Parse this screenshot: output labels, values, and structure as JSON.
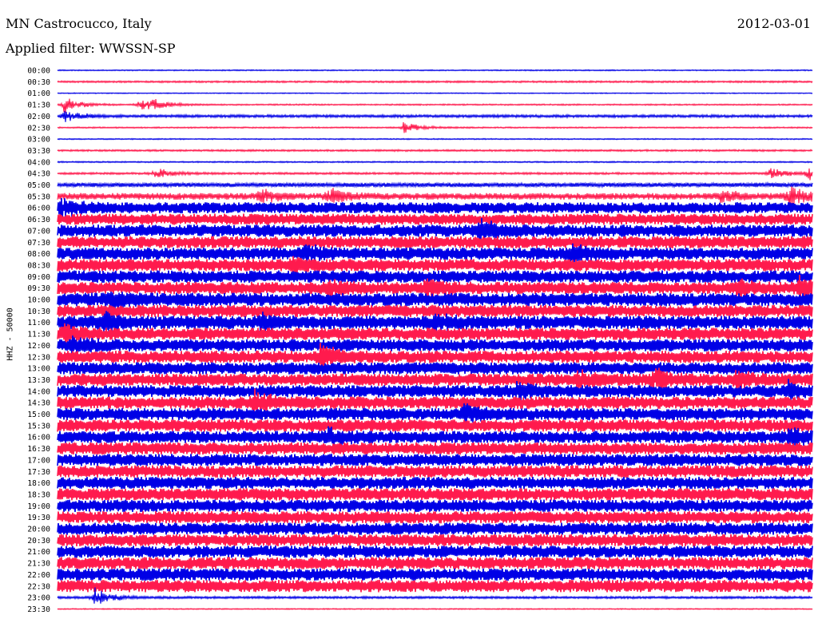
{
  "header": {
    "station": "MN Castrocucco, Italy",
    "date": "2012-03-01",
    "filter": "Applied filter: WWSSN-SP"
  },
  "colors": {
    "odd_trace": "#0000e6",
    "even_trace": "#ff1a4d"
  },
  "chart_data": {
    "type": "line",
    "title": "MN Castrocucco, Italy",
    "subtitle": "Applied filter: WWSSN-SP",
    "ylabel": "HHZ - 50000",
    "grid": false,
    "row_labels": [
      "00:00",
      "00:30",
      "01:00",
      "01:30",
      "02:00",
      "02:30",
      "03:00",
      "03:30",
      "04:00",
      "04:30",
      "05:00",
      "05:30",
      "06:00",
      "06:30",
      "07:00",
      "07:30",
      "08:00",
      "08:30",
      "09:00",
      "09:30",
      "10:00",
      "10:30",
      "11:00",
      "11:30",
      "12:00",
      "12:30",
      "13:00",
      "13:30",
      "14:00",
      "14:30",
      "15:00",
      "15:30",
      "16:00",
      "16:30",
      "17:00",
      "17:30",
      "18:00",
      "18:30",
      "19:00",
      "19:30",
      "20:00",
      "20:30",
      "21:00",
      "21:30",
      "22:00",
      "22:30",
      "23:00",
      "23:30"
    ],
    "noise_level": [
      0.5,
      0.8,
      0.4,
      0.6,
      1.2,
      0.6,
      0.5,
      0.8,
      0.6,
      0.9,
      2.0,
      3.0,
      5.0,
      5.0,
      5.5,
      5.5,
      5.5,
      5.5,
      5.5,
      5.5,
      6.0,
      5.5,
      6.0,
      5.5,
      5.5,
      5.5,
      5.5,
      5.5,
      5.5,
      5.5,
      5.5,
      5.5,
      5.5,
      5.5,
      5.5,
      5.5,
      5.5,
      5.5,
      5.5,
      5.5,
      5.5,
      5.5,
      5.5,
      5.5,
      5.5,
      5.5,
      1.0,
      0.5
    ],
    "events": [
      {
        "row": "01:30",
        "x_frac": 0.01,
        "amp": 10
      },
      {
        "row": "01:30",
        "x_frac": 0.11,
        "amp": 8
      },
      {
        "row": "01:30",
        "x_frac": 0.127,
        "amp": 5
      },
      {
        "row": "02:00",
        "x_frac": 0.01,
        "amp": 8
      },
      {
        "row": "02:30",
        "x_frac": 0.46,
        "amp": 7
      },
      {
        "row": "04:30",
        "x_frac": 0.13,
        "amp": 7
      },
      {
        "row": "04:30",
        "x_frac": 0.945,
        "amp": 7
      },
      {
        "row": "04:30",
        "x_frac": 0.995,
        "amp": 9
      },
      {
        "row": "05:30",
        "x_frac": 0.27,
        "amp": 9
      },
      {
        "row": "05:30",
        "x_frac": 0.36,
        "amp": 10
      },
      {
        "row": "05:30",
        "x_frac": 0.97,
        "amp": 12
      },
      {
        "row": "05:30",
        "x_frac": 0.88,
        "amp": 8
      },
      {
        "row": "06:00",
        "x_frac": 0.005,
        "amp": 10
      },
      {
        "row": "07:00",
        "x_frac": 0.56,
        "amp": 12
      },
      {
        "row": "08:00",
        "x_frac": 0.33,
        "amp": 9
      },
      {
        "row": "08:00",
        "x_frac": 0.68,
        "amp": 10
      },
      {
        "row": "08:30",
        "x_frac": 0.31,
        "amp": 8
      },
      {
        "row": "09:30",
        "x_frac": 0.36,
        "amp": 11
      },
      {
        "row": "09:30",
        "x_frac": 0.49,
        "amp": 10
      },
      {
        "row": "09:30",
        "x_frac": 0.985,
        "amp": 11
      },
      {
        "row": "09:30",
        "x_frac": 0.9,
        "amp": 8
      },
      {
        "row": "10:00",
        "x_frac": 0.07,
        "amp": 9
      },
      {
        "row": "11:00",
        "x_frac": 0.06,
        "amp": 10
      },
      {
        "row": "11:00",
        "x_frac": 0.27,
        "amp": 9
      },
      {
        "row": "11:00",
        "x_frac": 0.5,
        "amp": 9
      },
      {
        "row": "11:30",
        "x_frac": 0.01,
        "amp": 9
      },
      {
        "row": "12:00",
        "x_frac": 0.02,
        "amp": 9
      },
      {
        "row": "12:30",
        "x_frac": 0.35,
        "amp": 12
      },
      {
        "row": "13:30",
        "x_frac": 0.69,
        "amp": 9
      },
      {
        "row": "13:30",
        "x_frac": 0.79,
        "amp": 12
      },
      {
        "row": "13:30",
        "x_frac": 0.9,
        "amp": 10
      },
      {
        "row": "14:00",
        "x_frac": 0.61,
        "amp": 9
      },
      {
        "row": "14:00",
        "x_frac": 0.97,
        "amp": 8
      },
      {
        "row": "14:30",
        "x_frac": 0.26,
        "amp": 14
      },
      {
        "row": "15:00",
        "x_frac": 0.54,
        "amp": 8
      },
      {
        "row": "16:00",
        "x_frac": 0.36,
        "amp": 9
      },
      {
        "row": "16:00",
        "x_frac": 0.97,
        "amp": 10
      },
      {
        "row": "23:00",
        "x_frac": 0.05,
        "amp": 12
      }
    ]
  }
}
